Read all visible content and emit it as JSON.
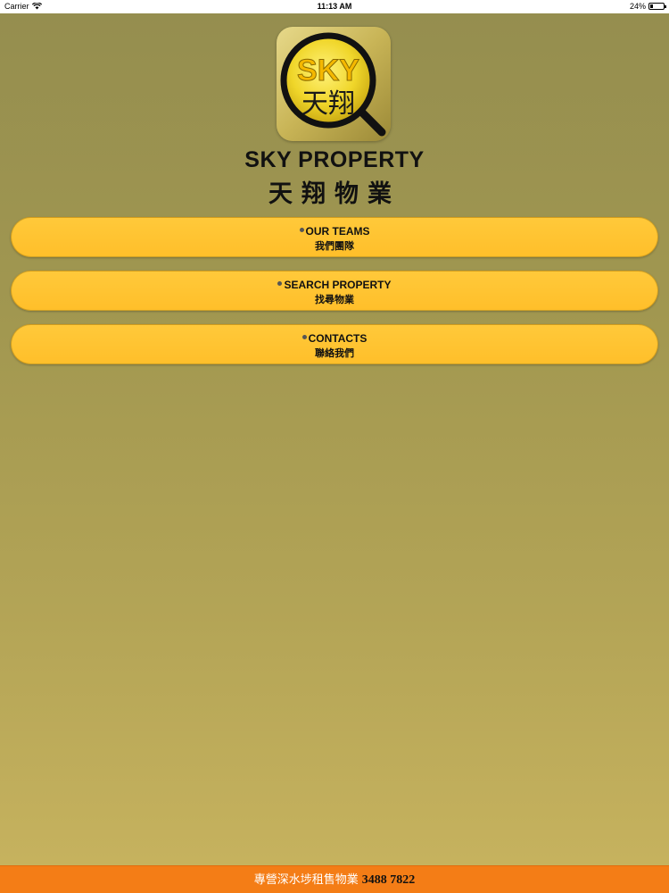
{
  "status_bar": {
    "carrier": "Carrier",
    "time": "11:13 AM",
    "battery_text": "24%",
    "battery_level": 0.24,
    "wifi_icon": "wifi-icon",
    "battery_icon": "battery-icon"
  },
  "logo": {
    "en": "SKY",
    "zh": "天翔",
    "icon": "magnifier-logo-icon"
  },
  "brand": {
    "name_en": "SKY PROPERTY",
    "name_zh": "天翔物業"
  },
  "menu": [
    {
      "title": "OUR TEAMS",
      "subtitle": "我們團隊"
    },
    {
      "title": "SEARCH PROPERTY",
      "subtitle": "找尋物業"
    },
    {
      "title": "CONTACTS",
      "subtitle": "聯絡我們"
    }
  ],
  "footer": {
    "text": "專營深水埗租售物業",
    "phone": "3488 7822"
  },
  "colors": {
    "button": "#ffc12e",
    "footer": "#f47d16",
    "background_top": "#958e4f",
    "background_bottom": "#c6b25e"
  }
}
